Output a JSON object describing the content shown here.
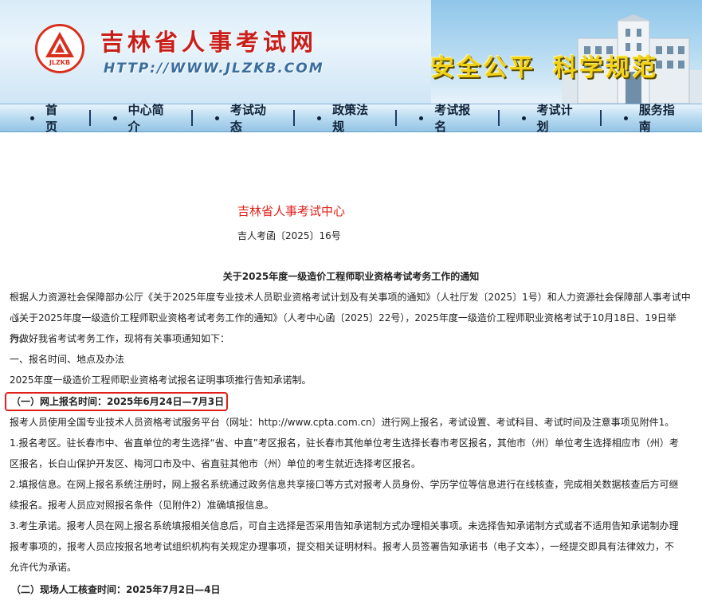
{
  "header": {
    "site_title": "吉林省人事考试网",
    "site_url": "HTTP://WWW.JLZKB.COM",
    "logo_text": "JLZKB",
    "slogan_1": "安全公平",
    "slogan_2": "科学规范"
  },
  "nav": {
    "items": [
      {
        "label": "首 页"
      },
      {
        "label": "中心简介"
      },
      {
        "label": "考试动态"
      },
      {
        "label": "政策法规"
      },
      {
        "label": "考试报名"
      },
      {
        "label": "考试计划"
      },
      {
        "label": "服务指南"
      }
    ]
  },
  "article": {
    "org_name": "吉林省人事考试中心",
    "doc_no": "吉人考函〔2025〕16号",
    "title": "关于2025年度一级造价工程师职业资格考试考务工作的通知",
    "p1_l1": "根据人力资源社会保障部办公厅《关于2025年度专业技术人员职业资格考试计划及有关事项的通知》（人社厅发〔2025〕1号）和人力资源社会保障部人事考试中心",
    "p1_l2": "《关于2025年度一级造价工程师职业资格考试考务工作的通知》（人考中心函〔2025〕22号），2025年度一级造价工程师职业资格考试于10月18日、19日举行。",
    "p1_l3": "为做好我省考试考务工作，现将有关事项通知如下：",
    "s1": "一、报名时间、地点及办法",
    "s1_p": "2025年度一级造价工程师职业资格考试报名证明事项推行告知承诺制。",
    "sub1": "（一）网上报名时间：2025年6月24日—7月3日",
    "sub1_p": "报考人员使用全国专业技术人员资格考试服务平台（网址：http://www.cpta.com.cn）进行网上报名，考试设置、考试科目、考试时间及注意事项见附件1。",
    "i1_l1": "1.报名考区。驻长春市中、省直单位的考生选择“省、中直”考区报名，驻长春市其他单位考生选择长春市考区报名，其他市（州）单位考生选择相应市（州）考",
    "i1_l2": "区报名，长白山保护开发区、梅河口市及中、省直驻其他市（州）单位的考生就近选择考区报名。",
    "i2_l1": "2.填报信息。在网上报名系统注册时，网上报名系统通过政务信息共享接口等方式对报考人员身份、学历学位等信息进行在线核查，完成相关数据核查后方可继",
    "i2_l2": "续报名。报考人员应对照报名条件（见附件2）准确填报信息。",
    "i3_l1": "3.考生承诺。报考人员在网上报名系统填报相关信息后，可自主选择是否采用告知承诺制方式办理相关事项。未选择告知承诺制方式或者不适用告知承诺制办理",
    "i3_l2": "报考事项的，报考人员应按报名地考试组织机构有关规定办理事项，提交相关证明材料。报考人员签署告知承诺书（电子文本），一经提交即具有法律效力，不",
    "i3_l3": "允许代为承诺。",
    "sub2": "（二）现场人工核查时间：2025年7月2日—4日"
  },
  "colors": {
    "brand_red": "#c81f1a",
    "highlight_red": "#e0201a",
    "nav_text": "#0f2238",
    "slogan_yellow": "#f1d21a"
  }
}
